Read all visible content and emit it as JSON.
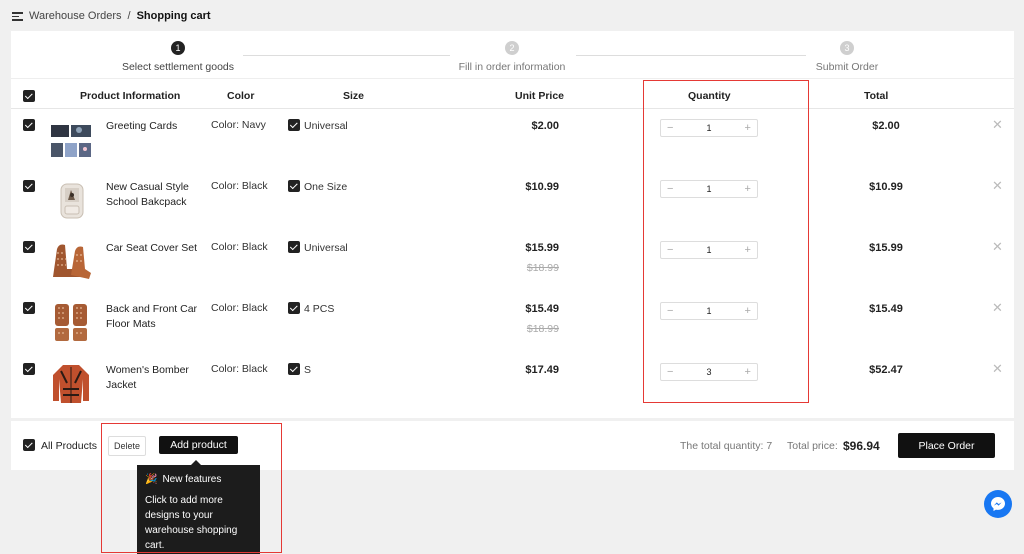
{
  "breadcrumb": {
    "icon": "menu-icon",
    "parent": "Warehouse Orders",
    "separator": "/",
    "current": "Shopping cart"
  },
  "steps": [
    {
      "num": "1",
      "label": "Select settlement goods",
      "active": true
    },
    {
      "num": "2",
      "label": "Fill in order information",
      "active": false
    },
    {
      "num": "3",
      "label": "Submit Order",
      "active": false
    }
  ],
  "table": {
    "headers": {
      "product": "Product Information",
      "color": "Color",
      "size": "Size",
      "unit_price": "Unit Price",
      "quantity": "Quantity",
      "total": "Total"
    },
    "rows": [
      {
        "name": "Greeting Cards",
        "color": "Color: Navy",
        "size": "Universal",
        "price": "$2.00",
        "old_price": "",
        "qty": "1",
        "total": "$2.00",
        "thumb": "greeting-cards"
      },
      {
        "name": "New Casual Style School Bakcpack",
        "color": "Color: Black",
        "size": "One Size",
        "price": "$10.99",
        "old_price": "",
        "qty": "1",
        "total": "$10.99",
        "thumb": "backpack"
      },
      {
        "name": "Car Seat Cover Set",
        "color": "Color: Black",
        "size": "Universal",
        "price": "$15.99",
        "old_price": "$18.99",
        "qty": "1",
        "total": "$15.99",
        "thumb": "seat-cover"
      },
      {
        "name": "Back and Front Car Floor Mats",
        "color": "Color: Black",
        "size": "4 PCS",
        "price": "$15.49",
        "old_price": "$18.99",
        "qty": "1",
        "total": "$15.49",
        "thumb": "floor-mats"
      },
      {
        "name": "Women's Bomber Jacket",
        "color": "Color: Black",
        "size": "S",
        "price": "$17.49",
        "old_price": "",
        "qty": "3",
        "total": "$52.47",
        "thumb": "bomber-jacket"
      }
    ],
    "stepper": {
      "minus": "−",
      "plus": "+"
    },
    "remove_glyph": "✕"
  },
  "footer": {
    "all_products": "All Products",
    "delete_label": "Delete",
    "add_product_label": "Add product",
    "total_quantity": "The total quantity: 7",
    "total_price_label": "Total price:",
    "total_price": "$96.94",
    "place_order_label": "Place Order"
  },
  "tooltip": {
    "title": "New features",
    "emoji": "🎉",
    "body": "Click to add more designs to your warehouse shopping cart."
  },
  "colors": {
    "accent": "#111111",
    "highlight": "#e53935",
    "messenger": "#1877f2"
  }
}
